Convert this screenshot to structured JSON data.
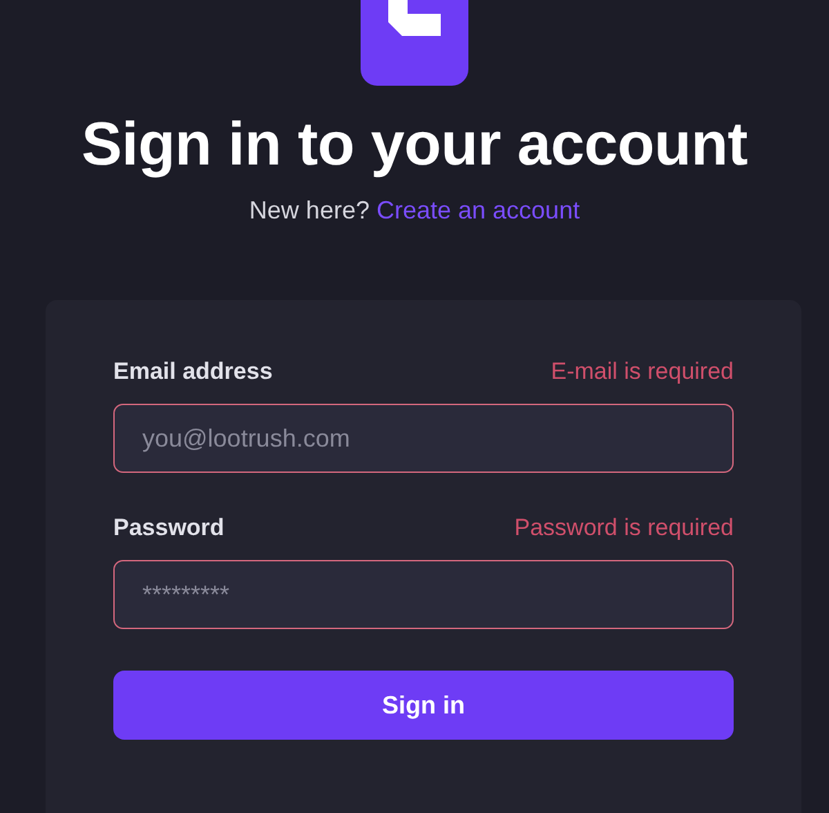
{
  "title": "Sign in to your account",
  "subtitle": {
    "text": "New here?",
    "link": "Create an account"
  },
  "fields": [
    {
      "label": "Email address",
      "error": "E-mail is required",
      "placeholder": "you@lootrush.com",
      "invalid": true
    },
    {
      "label": "Password",
      "error": "Password is required",
      "placeholder": "*********",
      "invalid": true
    }
  ],
  "submit": "Sign in"
}
